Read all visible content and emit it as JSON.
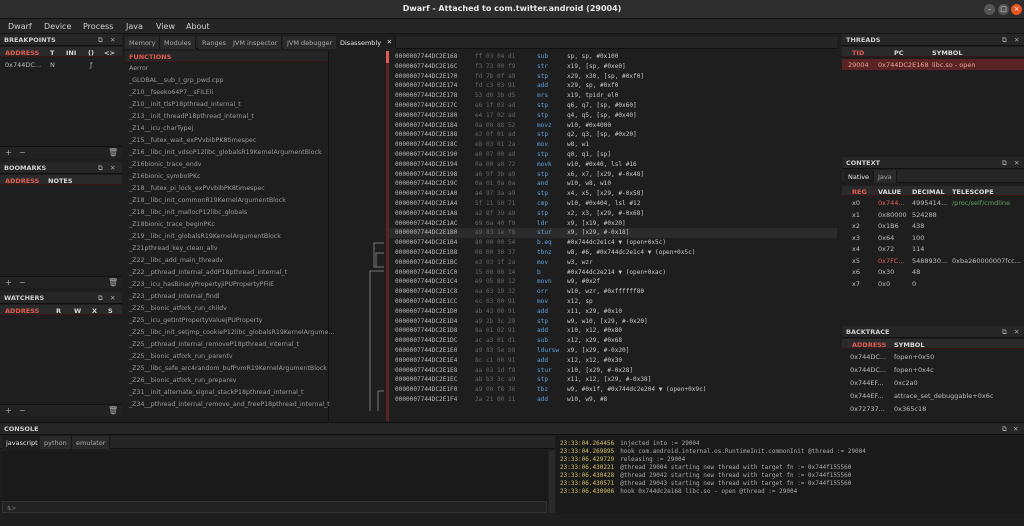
{
  "window": {
    "title": "Dwarf - Attached to com.twitter.android (29004)"
  },
  "menu": [
    "Dwarf",
    "Device",
    "Process",
    "Java",
    "View",
    "About"
  ],
  "breakpoints": {
    "title": "BREAKPOINTS",
    "columns": [
      "ADDRESS",
      "T",
      "INI",
      "()",
      "<>"
    ],
    "rows": [
      {
        "address": "0x744DC...",
        "t": "N",
        "ini": "",
        "fn": "ƒ"
      }
    ]
  },
  "bookmarks": {
    "title": "BOOMARKS",
    "columns": [
      "ADDRESS",
      "NOTES"
    ]
  },
  "watchers": {
    "title": "WATCHERS",
    "columns": [
      "ADDRESS",
      "R",
      "W",
      "X",
      "S"
    ]
  },
  "tabs": [
    "Memory",
    "Modules",
    "Ranges",
    "JVM inspector",
    "JVM debugger",
    "Disassembly"
  ],
  "active_tab": "Disassembly",
  "functions": {
    "title": "FUNCTIONS",
    "items": [
      "Aerror",
      "_GLOBAL__sub_I_grp_pwd.cpp",
      "_Z10__fseeko64P7__sFILEli",
      "_Z10__init_tlsP18pthread_internal_t",
      "_Z13__init_threadP18pthread_internal_t",
      "_Z14__icu_charTypej",
      "_Z15__futex_wait_exPVvbibPK8timespec",
      "_Z16__libc_init_vdsoP12libc_globalsR19KernelArgumentBlock",
      "_Z16bionic_trace_endv",
      "_Z16bionic_symbolPKc",
      "_Z18__futex_pi_lock_exPVvbibPK8timespec",
      "_Z18__libc_init_commonR19KernelArgumentBlock",
      "_Z18__libc_init_mallocP12libc_globals",
      "_Z18bionic_trace_beginPKc",
      "_Z19__libc_init_globalsR19KernelArgumentBlock",
      "_Z21pthread_key_clean_allv",
      "_Z22__libc_add_main_threadv",
      "_Z22__pthread_internal_addP18pthread_internal_t",
      "_Z23__icu_hasBinaryPropertyjiPUPropertyPFiiE",
      "_Z23__pthread_internal_findl",
      "_Z25__bionic_atfork_run_childv",
      "_Z25__icu_getIntPropertyValuejPUProperty",
      "_Z25__libc_init_setjmp_cookieP12libc_globalsR19KernelArgume...",
      "_Z25__pthread_internal_removeP18pthread_internal_t",
      "_Z25__bionic_atfork_run_parentv",
      "_Z25__libc_safe_arc4random_bufPvmR19KernelArgumentBlock",
      "_Z26__bionic_atfork_run_preparev",
      "_Z31__init_alternate_signal_stackP18pthread_internal_t",
      "_Z34__pthread_internal_remove_and_freeP18pthread_internal_t"
    ]
  },
  "disassembly": [
    {
      "addr": "0000007744DC2E168",
      "bytes": "ff 03 04 d1",
      "mn": "sub",
      "op": "sp, sp, #0x100"
    },
    {
      "addr": "0000007744DC2E16C",
      "bytes": "f3 73 00 f9",
      "mn": "str",
      "op": "x19, [sp, #0xe0]"
    },
    {
      "addr": "0000007744DC2E170",
      "bytes": "fd 7b 0f a9",
      "mn": "stp",
      "op": "x29, x30, [sp, #0xf0]"
    },
    {
      "addr": "0000007744DC2E174",
      "bytes": "fd c3 03 91",
      "mn": "add",
      "op": "x29, sp, #0xf0"
    },
    {
      "addr": "0000007744DC2E178",
      "bytes": "53 d0 3b d5",
      "mn": "mrs",
      "op": "x19, tpidr_el0"
    },
    {
      "addr": "0000007744DC2E17C",
      "bytes": "e6 1f 03 ad",
      "mn": "stp",
      "op": "q6, q7, [sp, #0x60]"
    },
    {
      "addr": "0000007744DC2E180",
      "bytes": "e4 17 02 ad",
      "mn": "stp",
      "op": "q4, q5, [sp, #0x40]"
    },
    {
      "addr": "0000007744DC2E184",
      "bytes": "0a 00 88 52",
      "mn": "movz",
      "op": "w10, #0x4000"
    },
    {
      "addr": "0000007744DC2E188",
      "bytes": "e2 0f 01 ad",
      "mn": "stp",
      "op": "q2, q3, [sp, #0x20]"
    },
    {
      "addr": "0000007744DC2E18C",
      "bytes": "e8 03 01 2a",
      "mn": "mov",
      "op": "w8, w1"
    },
    {
      "addr": "0000007744DC2E190",
      "bytes": "e0 07 00 ad",
      "mn": "stp",
      "op": "q0, q1, [sp]"
    },
    {
      "addr": "0000007744DC2E194",
      "bytes": "0a 00 a0 72",
      "mn": "movk",
      "op": "w10, #0x40, lsl #16"
    },
    {
      "addr": "0000007744DC2E198",
      "bytes": "a6 9f 3b a9",
      "mn": "stp",
      "op": "x6, x7, [x29, #-0x48]"
    },
    {
      "addr": "0000007744DC2E19C",
      "bytes": "0a 01 0a 0a",
      "mn": "and",
      "op": "w10, w8, w10"
    },
    {
      "addr": "0000007744DC2E1A0",
      "bytes": "a4 97 3a a9",
      "mn": "stp",
      "op": "x4, x5, [x29, #-0x58]"
    },
    {
      "addr": "0000007744DC2E1A4",
      "bytes": "5f 11 50 71",
      "mn": "cmp",
      "op": "w10, #0x404, lsl #12"
    },
    {
      "addr": "0000007744DC2E1A8",
      "bytes": "a2 8f 39 a9",
      "mn": "stp",
      "op": "x2, x3, [x29, #-0x68]"
    },
    {
      "addr": "0000007744DC2E1AC",
      "bytes": "69 6a 40 f9",
      "mn": "ldr",
      "op": "x9, [x19, #0x20]"
    },
    {
      "addr": "0000007744DC2E1B0",
      "bytes": "a9 83 1e f8",
      "mn": "stur",
      "op": "x9, [x29, #-0x18]"
    },
    {
      "addr": "0000007744DC2E1B4",
      "bytes": "80 00 00 54",
      "mn": "b.eq",
      "op": "#0x744dc2e1c4 ▼ (open+0x5c)"
    },
    {
      "addr": "0000007744DC2E1B8",
      "bytes": "08 00 30 37",
      "mn": "tbnz",
      "op": "w8, #6, #0x744dc2e1c4 ▼ (open+0x5c)"
    },
    {
      "addr": "0000007744DC2E1BC",
      "bytes": "e3 03 1f 2a",
      "mn": "mov",
      "op": "w3, wzr"
    },
    {
      "addr": "0000007744DC2E1C0",
      "bytes": "15 00 00 14",
      "mn": "b",
      "op": "#0x744dc2e214 ▼ (open+0xac)"
    },
    {
      "addr": "0000007744DC2E1C4",
      "bytes": "e9 05 80 12",
      "mn": "movn",
      "op": "w9, #0x2f"
    },
    {
      "addr": "0000007744DC2E1C8",
      "bytes": "ea 63 19 32",
      "mn": "orr",
      "op": "w10, wzr, #0xffffff80"
    },
    {
      "addr": "0000007744DC2E1CC",
      "bytes": "ec 03 00 91",
      "mn": "mov",
      "op": "x12, sp"
    },
    {
      "addr": "0000007744DC2E1D0",
      "bytes": "ab 43 00 91",
      "mn": "add",
      "op": "x11, x29, #0x10"
    },
    {
      "addr": "0000007744DC2E1D4",
      "bytes": "a9 2b 3c 29",
      "mn": "stp",
      "op": "w9, w10, [x29, #-0x20]"
    },
    {
      "addr": "0000007744DC2E1D8",
      "bytes": "8a 01 02 91",
      "mn": "add",
      "op": "x10, x12, #0x80"
    },
    {
      "addr": "0000007744DC2E1DC",
      "bytes": "ac a3 01 d1",
      "mn": "sub",
      "op": "x12, x29, #0x68"
    },
    {
      "addr": "0000007744DC2E1E0",
      "bytes": "a9 83 5e b8",
      "mn": "ldursw",
      "op": "x9, [x29, #-0x20]"
    },
    {
      "addr": "0000007744DC2E1E4",
      "bytes": "8c c1 00 91",
      "mn": "add",
      "op": "x12, x12, #0x30"
    },
    {
      "addr": "0000007744DC2E1E8",
      "bytes": "aa 03 1d f8",
      "mn": "stur",
      "op": "x10, [x29, #-0x28]"
    },
    {
      "addr": "0000007744DC2E1EC",
      "bytes": "ab b3 3c a9",
      "mn": "stp",
      "op": "x11, x12, [x29, #-0x38]"
    },
    {
      "addr": "0000007744DC2E1F0",
      "bytes": "a9 00 f8 36",
      "mn": "tbz",
      "op": "w9, #0x1f, #0x744dc2e204 ▼ (open+0x9c)"
    },
    {
      "addr": "0000007744DC2E1F4",
      "bytes": "2a 21 00 11",
      "mn": "add",
      "op": "w10, w9, #8"
    }
  ],
  "threads": {
    "title": "THREADS",
    "columns": [
      "TID",
      "PC",
      "SYMBOL"
    ],
    "rows": [
      {
        "tid": "29004",
        "pc": "0x744DC2E168",
        "symbol": "libc.so - open"
      }
    ]
  },
  "context": {
    "title": "CONTEXT",
    "tabs": [
      "Native",
      "Java"
    ],
    "columns": [
      "REG",
      "VALUE",
      "DECIMAL",
      "TELESCOPE"
    ],
    "rows": [
      {
        "reg": "x0",
        "value": "0x744...",
        "decimal": "4995414...",
        "telescope": "/proc/self/cmdline"
      },
      {
        "reg": "x1",
        "value": "0x80000",
        "decimal": "524288",
        "telescope": ""
      },
      {
        "reg": "x2",
        "value": "0x1B6",
        "decimal": "438",
        "telescope": ""
      },
      {
        "reg": "x3",
        "value": "0x64",
        "decimal": "100",
        "telescope": ""
      },
      {
        "reg": "x4",
        "value": "0x72",
        "decimal": "114",
        "telescope": ""
      },
      {
        "reg": "x5",
        "value": "0x7FC...",
        "decimal": "5488930...",
        "telescope": "0xba260000007fcc..."
      },
      {
        "reg": "x6",
        "value": "0x30",
        "decimal": "48",
        "telescope": ""
      },
      {
        "reg": "x7",
        "value": "0x0",
        "decimal": "0",
        "telescope": ""
      }
    ]
  },
  "backtrace": {
    "title": "BACKTRACE",
    "columns": [
      "ADDRESS",
      "SYMBOL"
    ],
    "rows": [
      {
        "address": "0x744DC...",
        "symbol": "fopen+0x50"
      },
      {
        "address": "0x744DC...",
        "symbol": "fopen+0x4c"
      },
      {
        "address": "0x744EF...",
        "symbol": "0xc2a0"
      },
      {
        "address": "0x744EF...",
        "symbol": "attrace_set_debuggable+0x6c"
      },
      {
        "address": "0x72737...",
        "symbol": "0x365c18"
      }
    ]
  },
  "console": {
    "title": "CONSOLE",
    "tabs": [
      "javascript",
      "python",
      "emulator"
    ],
    "prompt": "$>",
    "log": [
      {
        "ts": "23:33:04.264456",
        "msg": "injected into := 29004"
      },
      {
        "ts": "23:33:04.269895",
        "msg": "hook com.android.internal.os.RuntimeInit.commonInit  @thread := 29004"
      },
      {
        "ts": "23:33:06.429729",
        "msg": "releasing := 29004"
      },
      {
        "ts": "23:33:06.430221",
        "msg": "@thread 29004 starting new thread with target fn := 0x744f155560"
      },
      {
        "ts": "23:33:06.430428",
        "msg": "@thread 29042 starting new thread with target fn := 0x744f155560"
      },
      {
        "ts": "23:33:06.430571",
        "msg": "@thread 29043 starting new thread with target fn := 0x744f155560"
      },
      {
        "ts": "23:33:06.430906",
        "msg": "hook 0x744dc2e168 libc.so - open @thread := 29004"
      }
    ]
  },
  "colors": {
    "accent": "#e05a4f",
    "mnemonic": "#5aa3e0",
    "timestamp": "#d2c26b",
    "selection": "#5a2424"
  }
}
